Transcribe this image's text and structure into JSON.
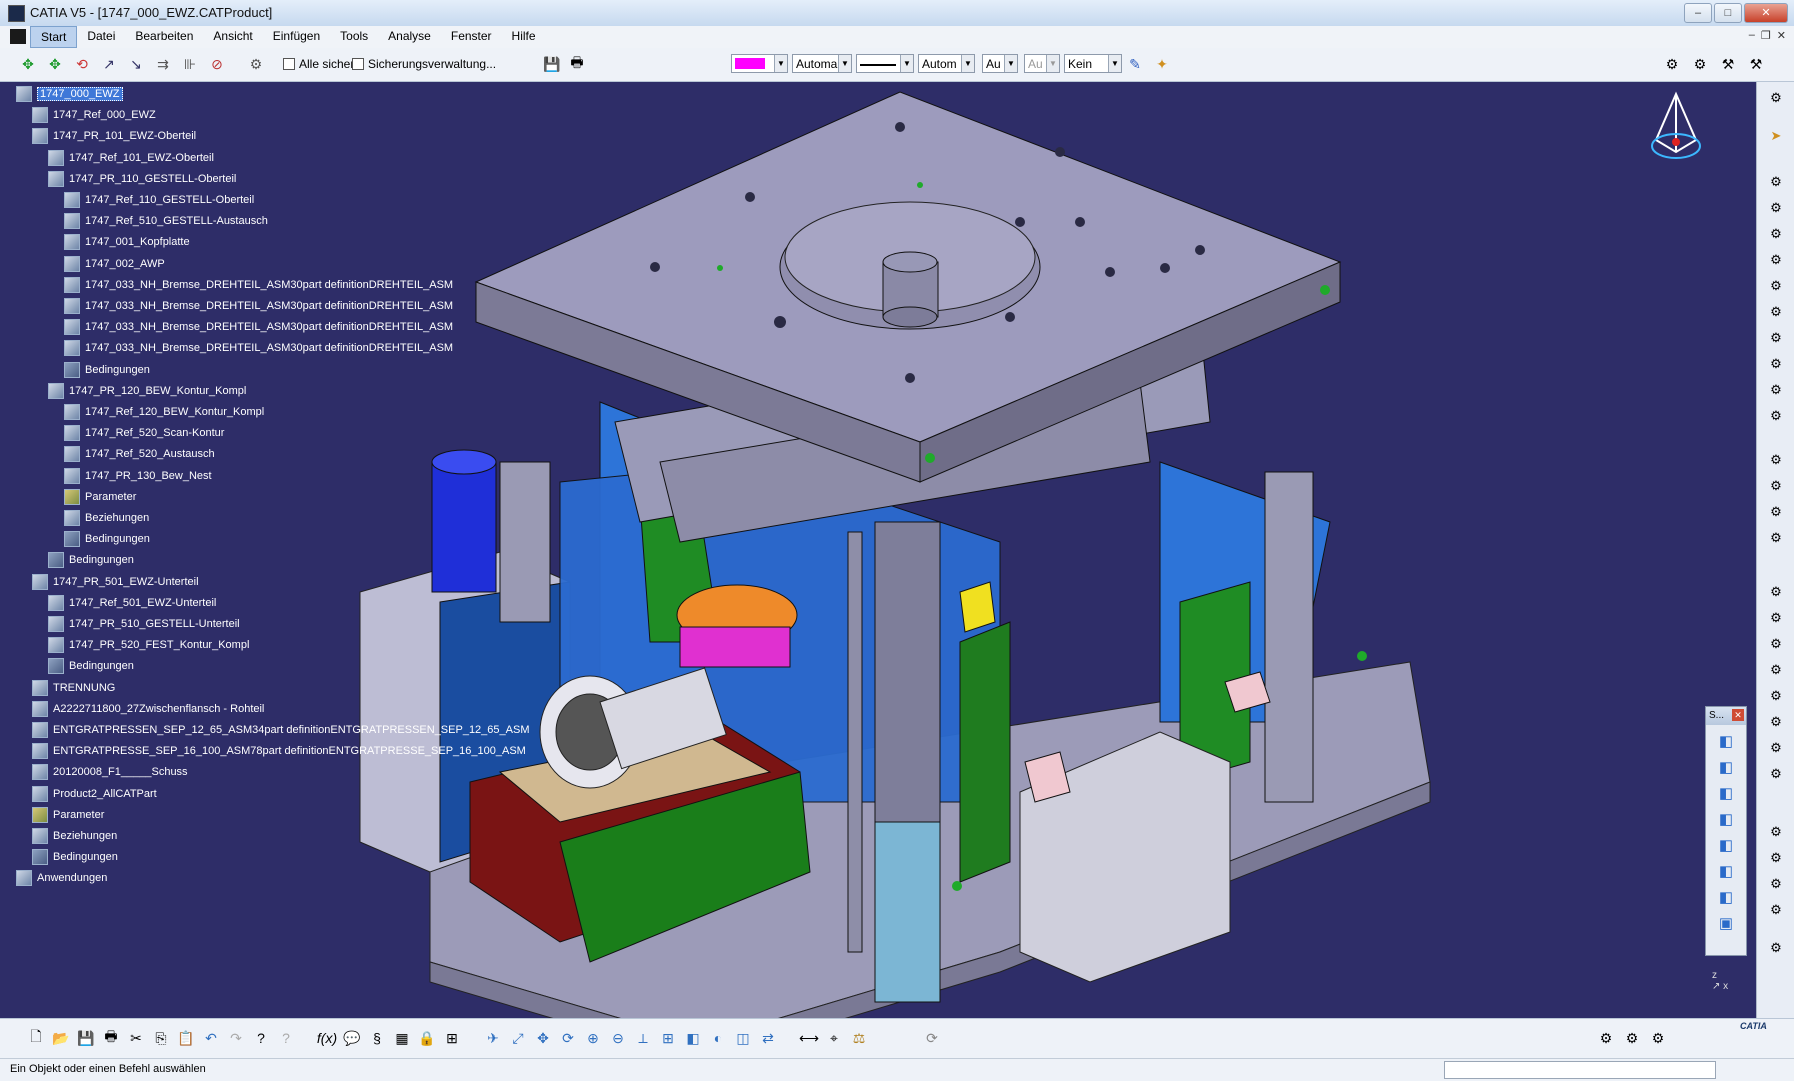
{
  "window": {
    "title": "CATIA V5 - [1747_000_EWZ.CATProduct]",
    "btn_min": "–",
    "btn_max": "□",
    "btn_close": "✕"
  },
  "menu": [
    "Start",
    "Datei",
    "Bearbeiten",
    "Ansicht",
    "Einfügen",
    "Tools",
    "Analyse",
    "Fenster",
    "Hilfe"
  ],
  "toolbar": {
    "save_all_label": "Alle sichern",
    "backup_label": "Sicherungsverwaltung...",
    "color_value": "#ff00ff",
    "combo_auto1": "Automa",
    "combo_auto2": "Autom",
    "combo_au1": "Au",
    "combo_au2": "Au",
    "combo_kein": "Kein"
  },
  "tree": [
    {
      "label": "1747_000_EWZ",
      "level": 0,
      "selected": true,
      "icon": "product-icon"
    },
    {
      "label": "1747_Ref_000_EWZ",
      "level": 1,
      "icon": "part-icon"
    },
    {
      "label": "1747_PR_101_EWZ-Oberteil",
      "level": 1,
      "icon": "product-icon"
    },
    {
      "label": "1747_Ref_101_EWZ-Oberteil",
      "level": 2,
      "icon": "part-icon"
    },
    {
      "label": "1747_PR_110_GESTELL-Oberteil",
      "level": 2,
      "icon": "product-icon"
    },
    {
      "label": "1747_Ref_110_GESTELL-Oberteil",
      "level": 3,
      "icon": "part-icon"
    },
    {
      "label": "1747_Ref_510_GESTELL-Austausch",
      "level": 3,
      "icon": "part-icon"
    },
    {
      "label": "1747_001_Kopfplatte",
      "level": 3,
      "icon": "part-icon"
    },
    {
      "label": "1747_002_AWP",
      "level": 3,
      "icon": "product-icon"
    },
    {
      "label": "1747_033_NH_Bremse_DREHTEIL_ASM30part definitionDREHTEIL_ASM",
      "level": 3,
      "icon": "product-icon"
    },
    {
      "label": "1747_033_NH_Bremse_DREHTEIL_ASM30part definitionDREHTEIL_ASM",
      "level": 3,
      "icon": "product-icon"
    },
    {
      "label": "1747_033_NH_Bremse_DREHTEIL_ASM30part definitionDREHTEIL_ASM",
      "level": 3,
      "icon": "product-icon"
    },
    {
      "label": "1747_033_NH_Bremse_DREHTEIL_ASM30part definitionDREHTEIL_ASM",
      "level": 3,
      "icon": "product-icon"
    },
    {
      "label": "Bedingungen",
      "level": 3,
      "icon": "constraints-icon"
    },
    {
      "label": "1747_PR_120_BEW_Kontur_Kompl",
      "level": 2,
      "icon": "product-icon"
    },
    {
      "label": "1747_Ref_120_BEW_Kontur_Kompl",
      "level": 3,
      "icon": "part-icon"
    },
    {
      "label": "1747_Ref_520_Scan-Kontur",
      "level": 3,
      "icon": "part-icon"
    },
    {
      "label": "1747_Ref_520_Austausch",
      "level": 3,
      "icon": "part-icon"
    },
    {
      "label": "1747_PR_130_Bew_Nest",
      "level": 3,
      "icon": "product-icon"
    },
    {
      "label": "Parameter",
      "level": 3,
      "icon": "parameter-icon"
    },
    {
      "label": "Beziehungen",
      "level": 3,
      "icon": "relations-icon"
    },
    {
      "label": "Bedingungen",
      "level": 3,
      "icon": "constraints-icon"
    },
    {
      "label": "Bedingungen",
      "level": 2,
      "icon": "constraints-icon"
    },
    {
      "label": "1747_PR_501_EWZ-Unterteil",
      "level": 1,
      "icon": "product-icon"
    },
    {
      "label": "1747_Ref_501_EWZ-Unterteil",
      "level": 2,
      "icon": "part-icon"
    },
    {
      "label": "1747_PR_510_GESTELL-Unterteil",
      "level": 2,
      "icon": "product-icon"
    },
    {
      "label": "1747_PR_520_FEST_Kontur_Kompl",
      "level": 2,
      "icon": "product-icon"
    },
    {
      "label": "Bedingungen",
      "level": 2,
      "icon": "constraints-icon"
    },
    {
      "label": "TRENNUNG",
      "level": 1,
      "icon": "part-icon"
    },
    {
      "label": "A2222711800_27Zwischenflansch - Rohteil",
      "level": 1,
      "icon": "part-icon"
    },
    {
      "label": "ENTGRATPRESSEN_SEP_12_65_ASM34part definitionENTGRATPRESSEN_SEP_12_65_ASM",
      "level": 1,
      "icon": "part-icon"
    },
    {
      "label": "ENTGRATPRESSE_SEP_16_100_ASM78part definitionENTGRATPRESSE_SEP_16_100_ASM",
      "level": 1,
      "icon": "part-icon"
    },
    {
      "label": "20120008_F1_____Schuss",
      "level": 1,
      "icon": "part-icon"
    },
    {
      "label": "Product2_AllCATPart",
      "level": 1,
      "icon": "part-icon"
    },
    {
      "label": "Parameter",
      "level": 1,
      "icon": "parameter-icon"
    },
    {
      "label": "Beziehungen",
      "level": 1,
      "icon": "relations-icon"
    },
    {
      "label": "Bedingungen",
      "level": 1,
      "icon": "constraints-icon"
    },
    {
      "label": "Anwendungen",
      "level": 0,
      "icon": "applications-icon"
    }
  ],
  "floating_toolbar": {
    "title": "S..."
  },
  "status": {
    "message": "Ein Objekt oder einen Befehl auswählen"
  },
  "brand": "CATIA"
}
